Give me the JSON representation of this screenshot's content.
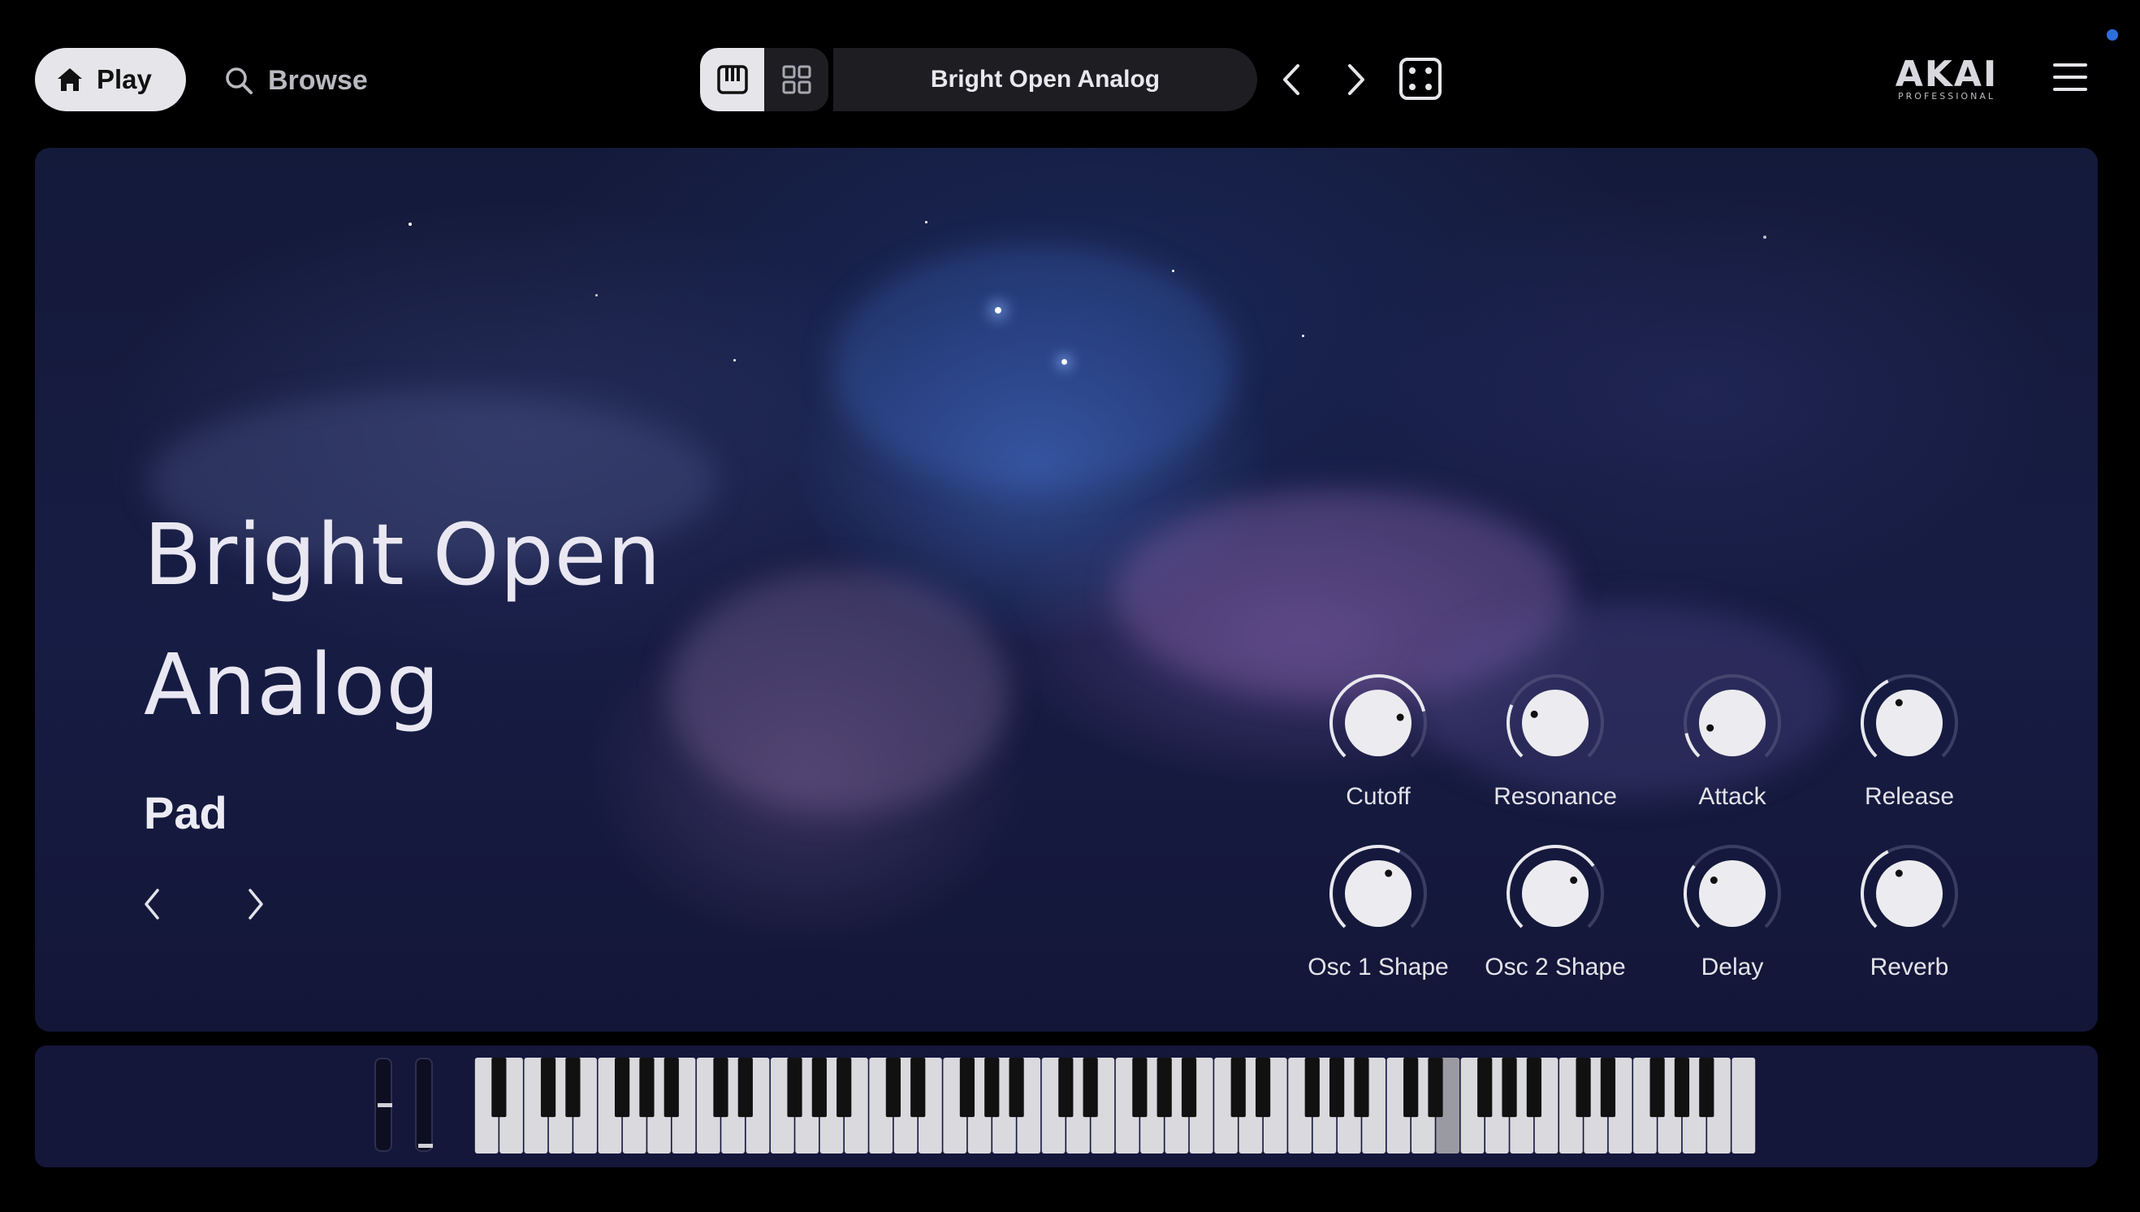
{
  "toolbar": {
    "play_label": "Play",
    "browse_label": "Browse",
    "preset_name": "Bright Open Analog",
    "brand": "AKAI",
    "brand_sub": "PROFESSIONAL"
  },
  "hero": {
    "title_line1": "Bright Open",
    "title_line2": "Analog",
    "category": "Pad"
  },
  "knobs": [
    {
      "label": "Cutoff",
      "value": 0.78
    },
    {
      "label": "Resonance",
      "value": 0.25
    },
    {
      "label": "Attack",
      "value": 0.12
    },
    {
      "label": "Release",
      "value": 0.4
    },
    {
      "label": "Osc 1 Shape",
      "value": 0.6
    },
    {
      "label": "Osc 2 Shape",
      "value": 0.7
    },
    {
      "label": "Delay",
      "value": 0.3
    },
    {
      "label": "Reverb",
      "value": 0.4
    }
  ],
  "colors": {
    "accent": "#2d6fe0",
    "panel": "#14163a",
    "key_highlight": "#9a9aa2"
  },
  "keyboard": {
    "white_keys": 52
  }
}
